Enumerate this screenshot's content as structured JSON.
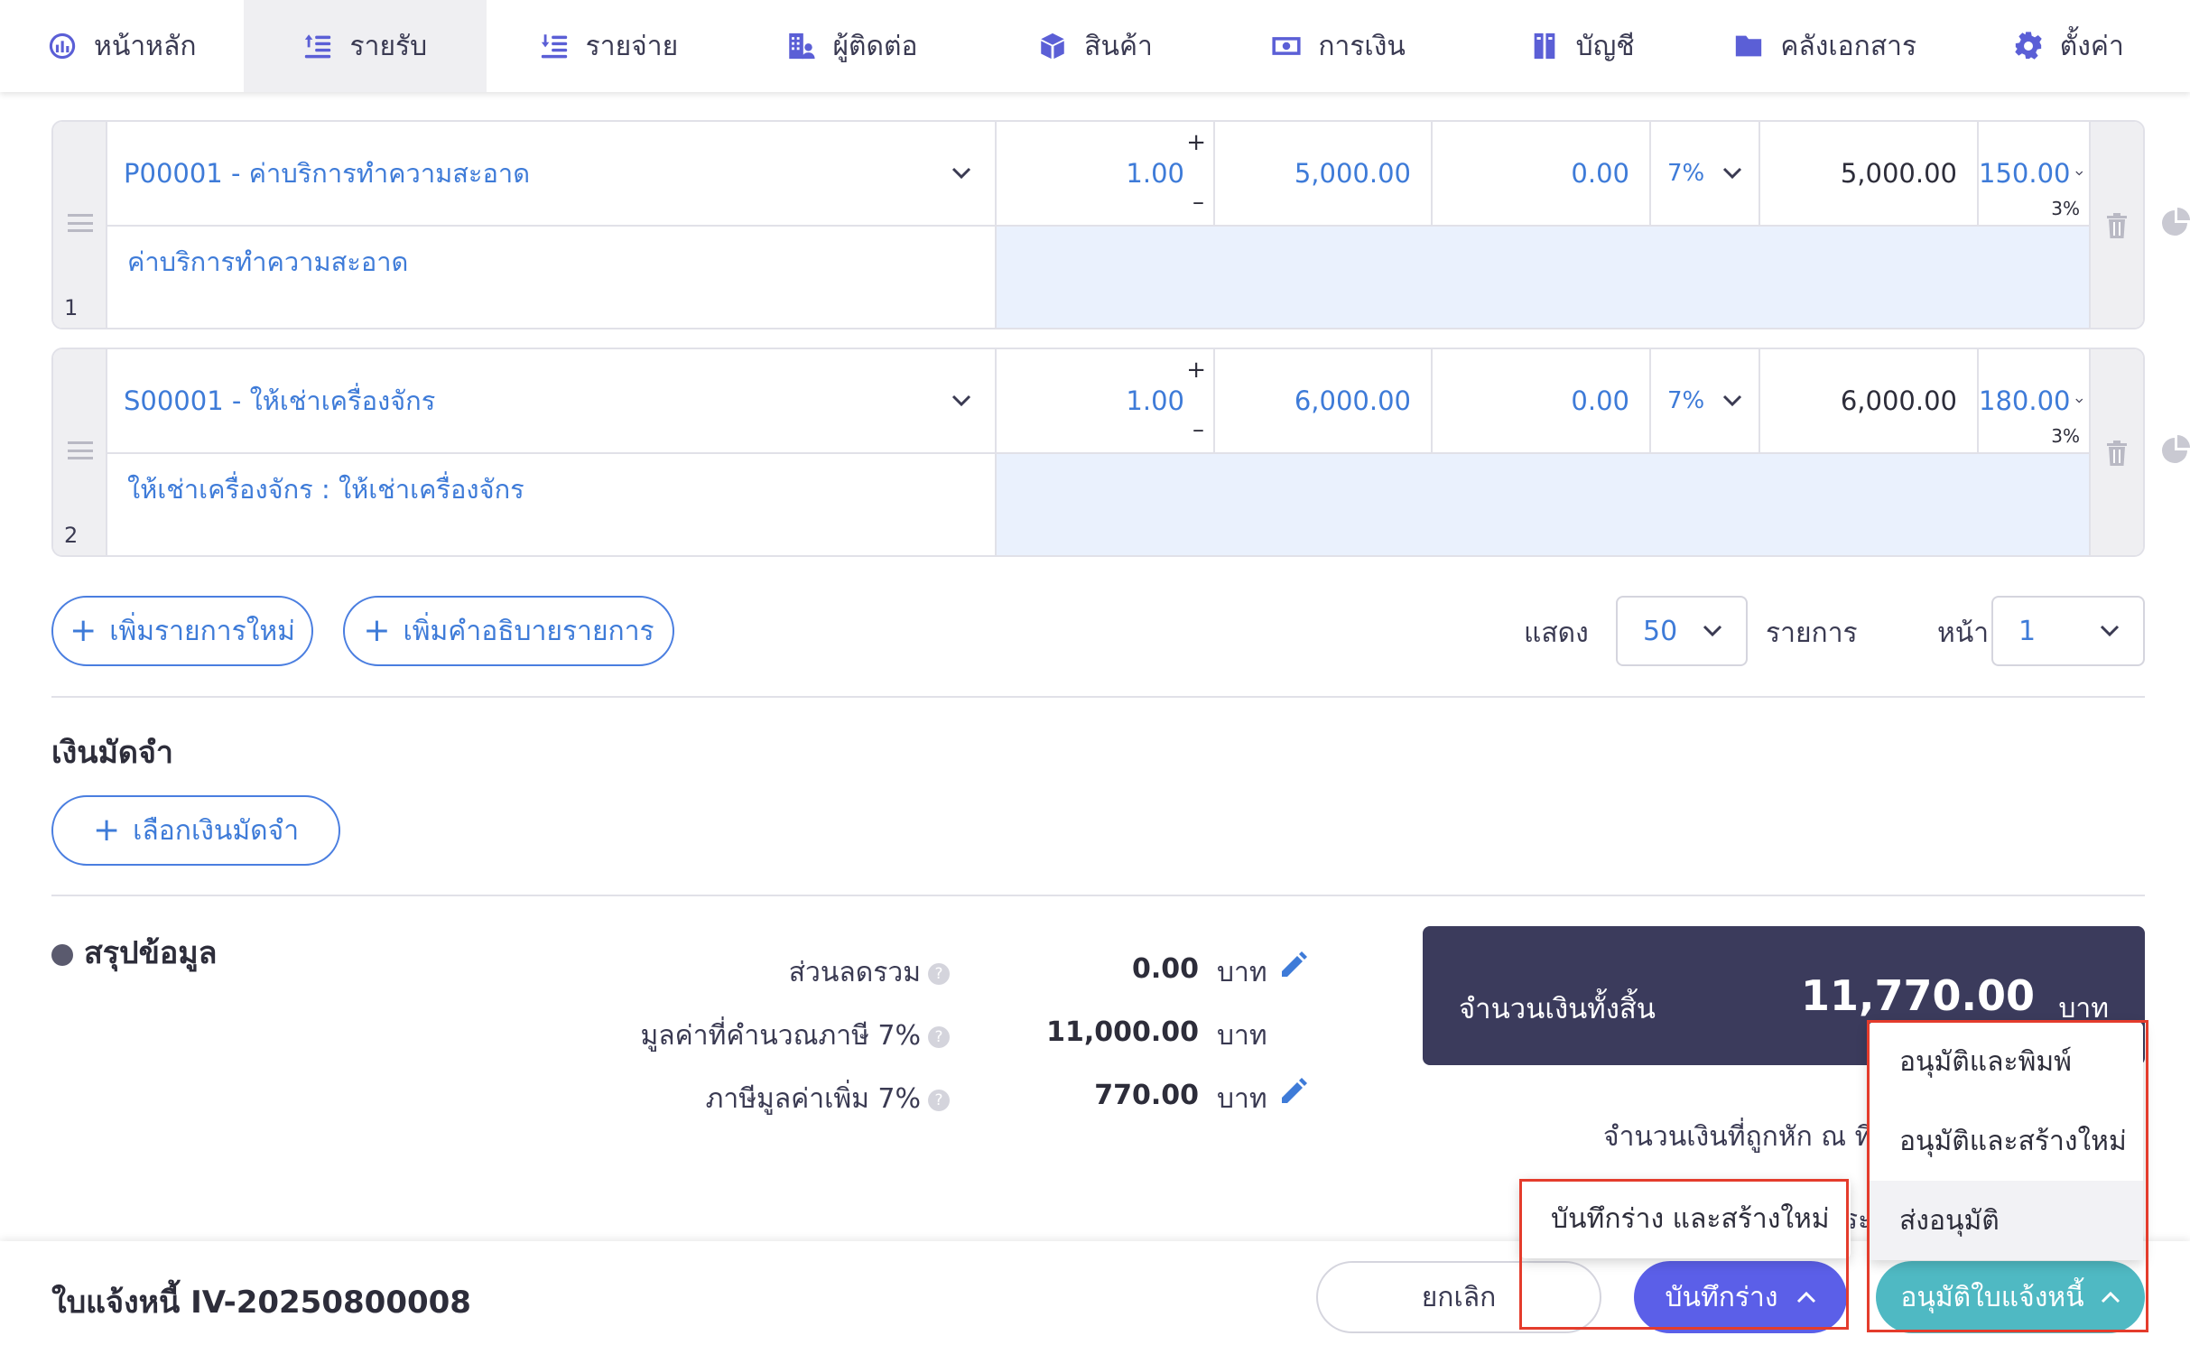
{
  "nav": [
    {
      "label": "หน้าหลัก",
      "icon": "dashboard-icon",
      "active": false
    },
    {
      "label": "รายรับ",
      "icon": "income-icon",
      "active": true
    },
    {
      "label": "รายจ่าย",
      "icon": "expense-icon",
      "active": false
    },
    {
      "label": "ผู้ติดต่อ",
      "icon": "contacts-icon",
      "active": false
    },
    {
      "label": "สินค้า",
      "icon": "product-box-icon",
      "active": false
    },
    {
      "label": "การเงิน",
      "icon": "money-icon",
      "active": false
    },
    {
      "label": "บัญชี",
      "icon": "ledger-icon",
      "active": false
    },
    {
      "label": "คลังเอกสาร",
      "icon": "folder-icon",
      "active": false
    },
    {
      "label": "ตั้งค่า",
      "icon": "gear-icon",
      "active": false
    }
  ],
  "line_items": [
    {
      "no": "1",
      "product": "P00001 - ค่าบริการทำความสะอาด",
      "qty": "1.00",
      "qty_plus": "+",
      "qty_minus": "–",
      "price": "5,000.00",
      "discount": "0.00",
      "vat": "7%",
      "amount": "5,000.00",
      "wht": "150.00",
      "wht_rate": "3%",
      "description": "ค่าบริการทำความสะอาด"
    },
    {
      "no": "2",
      "product": "S00001 - ให้เช่าเครื่องจักร",
      "qty": "1.00",
      "qty_plus": "+",
      "qty_minus": "–",
      "price": "6,000.00",
      "discount": "0.00",
      "vat": "7%",
      "amount": "6,000.00",
      "wht": "180.00",
      "wht_rate": "3%",
      "description": "ให้เช่าเครื่องจักร : ให้เช่าเครื่องจักร"
    }
  ],
  "buttons": {
    "add_item": "เพิ่มรายการใหม่",
    "add_description": "เพิ่มคำอธิบายรายการ",
    "select_deposit": "เลือกเงินมัดจำ",
    "plus": "+"
  },
  "pagination": {
    "show_label": "แสดง",
    "page_size": "50",
    "items_label": "รายการ",
    "page_label": "หน้า",
    "page": "1"
  },
  "deposit": {
    "title": "เงินมัดจำ"
  },
  "summary": {
    "title": "สรุปข้อมูล",
    "help": "?",
    "rows": [
      {
        "label": "ส่วนลดรวม",
        "value": "0.00",
        "unit": "บาท"
      },
      {
        "label": "มูลค่าที่คำนวณภาษี 7%",
        "value": "11,000.00",
        "unit": "บาท"
      },
      {
        "label": "ภาษีมูลค่าเพิ่ม 7%",
        "value": "770.00",
        "unit": "บาท"
      }
    ],
    "total_label": "จำนวนเงินทั้งสิ้น",
    "total_value": "11,770.00",
    "total_unit": "บาท",
    "wht_label": "จำนวนเงินที่ถูกหัก ณ ที่",
    "peek_text": "ระ"
  },
  "footer": {
    "doc_title": "ใบแจ้งหนี้ IV-20250800008",
    "cancel": "ยกเลิก",
    "save_draft": "บันทึกร่าง",
    "approve": "อนุมัติใบแจ้งหนี้"
  },
  "draft_menu": [
    "บันทึกร่าง และสร้างใหม่"
  ],
  "approve_menu": [
    "อนุมัติและพิมพ์",
    "อนุมัติและสร้างใหม่",
    "ส่งอนุมัติ"
  ],
  "colors": {
    "primary": "#5b5fe8",
    "approve": "#4fb9c3",
    "link": "#3e7bd8",
    "total_bg": "#3b3b5c",
    "highlight": "#e43c2c"
  }
}
